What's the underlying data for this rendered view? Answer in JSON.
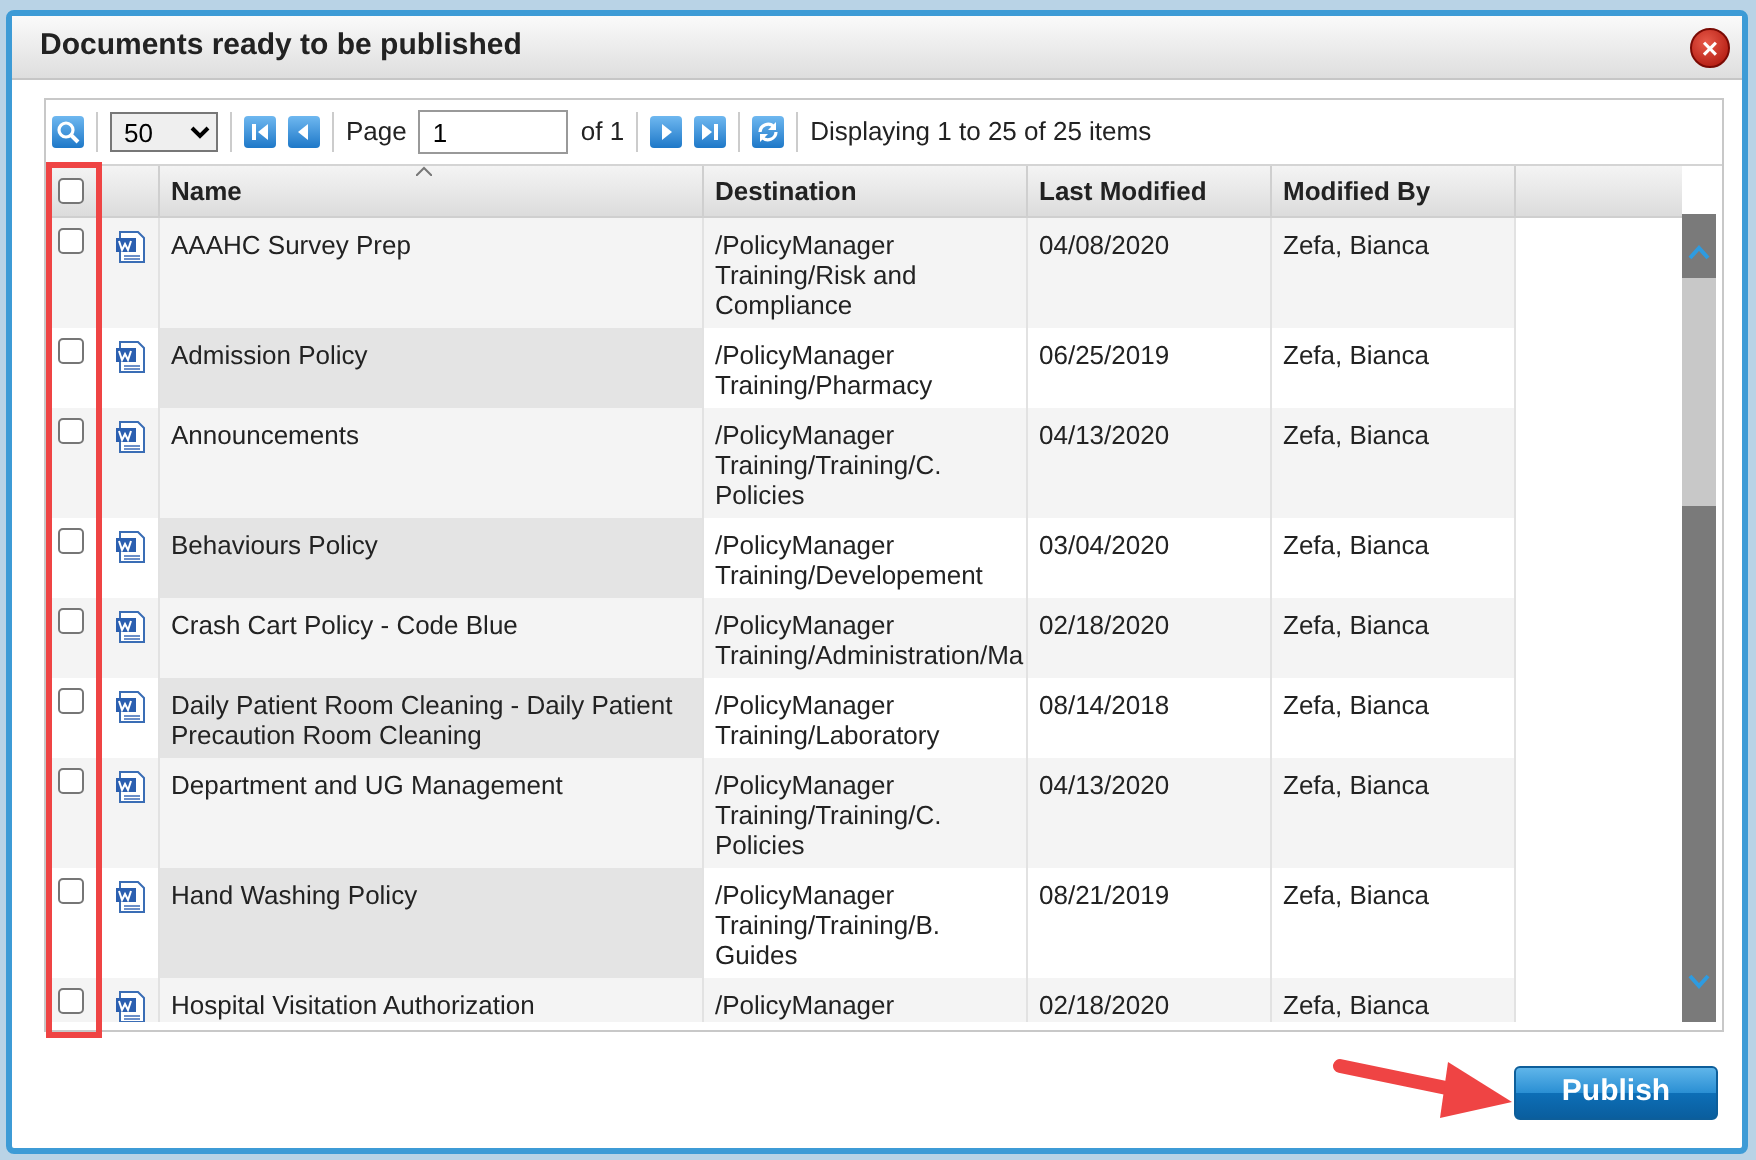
{
  "window": {
    "title": "Documents ready to be published",
    "close": "×"
  },
  "pager": {
    "page_size": "50",
    "page_label": "Page",
    "page": "1",
    "of": "of 1",
    "summary": "Displaying 1 to 25 of 25 items"
  },
  "table": {
    "select_all": {
      "checked": false
    },
    "columns": [
      "Name",
      "Destination",
      "Last Modified",
      "Modified By"
    ],
    "rows": [
      {
        "checked": false,
        "name": "AAAHC Survey Prep",
        "destination": [
          "/PolicyManager",
          "Training/Risk and",
          "Compliance"
        ],
        "modified": "04/08/2020",
        "by": "Zefa, Bianca"
      },
      {
        "checked": false,
        "name": "Admission Policy",
        "destination": [
          "/PolicyManager",
          "Training/Pharmacy"
        ],
        "modified": "06/25/2019",
        "by": "Zefa, Bianca"
      },
      {
        "checked": false,
        "name": "Announcements",
        "destination": [
          "/PolicyManager",
          "Training/Training/C.",
          "Policies"
        ],
        "modified": "04/13/2020",
        "by": "Zefa, Bianca"
      },
      {
        "checked": false,
        "name": "Behaviours Policy",
        "destination": [
          "/PolicyManager",
          "Training/Developement"
        ],
        "modified": "03/04/2020",
        "by": "Zefa, Bianca"
      },
      {
        "checked": false,
        "name": "Crash Cart Policy - Code Blue",
        "destination": [
          "/PolicyManager",
          "Training/Administration/Ma"
        ],
        "modified": "02/18/2020",
        "by": "Zefa, Bianca"
      },
      {
        "checked": false,
        "name": "Daily Patient Room Cleaning - Daily Patient Precaution Room Cleaning",
        "destination": [
          "/PolicyManager",
          "Training/Laboratory"
        ],
        "modified": "08/14/2018",
        "by": "Zefa, Bianca"
      },
      {
        "checked": false,
        "name": "Department and UG Management",
        "destination": [
          "/PolicyManager",
          "Training/Training/C.",
          "Policies"
        ],
        "modified": "04/13/2020",
        "by": "Zefa, Bianca"
      },
      {
        "checked": false,
        "name": "Hand Washing Policy",
        "destination": [
          "/PolicyManager",
          "Training/Training/B.",
          "Guides"
        ],
        "modified": "08/21/2019",
        "by": "Zefa, Bianca"
      },
      {
        "checked": false,
        "name": "Hospital Visitation Authorization",
        "destination": [
          "/PolicyManager"
        ],
        "modified": "02/18/2020",
        "by": "Zefa, Bianca"
      }
    ]
  },
  "buttons": [
    "Publish"
  ]
}
